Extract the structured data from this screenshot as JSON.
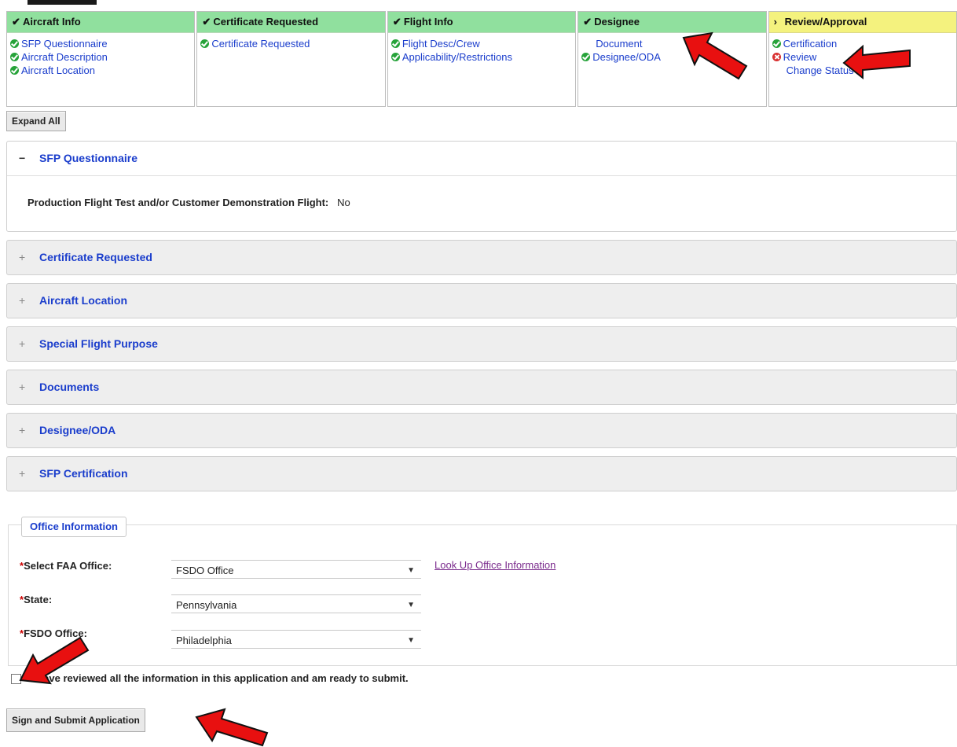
{
  "steps": [
    {
      "title": "Aircraft Info",
      "mark": "check",
      "items": [
        {
          "label": "SFP Questionnaire",
          "status": "ok"
        },
        {
          "label": "Aircraft Description",
          "status": "ok"
        },
        {
          "label": "Aircraft Location",
          "status": "ok"
        }
      ]
    },
    {
      "title": "Certificate Requested",
      "mark": "check",
      "items": [
        {
          "label": "Certificate Requested",
          "status": "ok"
        }
      ]
    },
    {
      "title": "Flight Info",
      "mark": "check",
      "items": [
        {
          "label": "Flight Desc/Crew",
          "status": "ok"
        },
        {
          "label": "Applicability/Restrictions",
          "status": "ok"
        }
      ]
    },
    {
      "title": "Designee",
      "mark": "check",
      "items": [
        {
          "label": "Document",
          "status": "none"
        },
        {
          "label": "Designee/ODA",
          "status": "ok"
        }
      ]
    },
    {
      "title": "Review/Approval",
      "mark": "current",
      "items": [
        {
          "label": "Certification",
          "status": "ok"
        },
        {
          "label": "Review",
          "status": "error"
        },
        {
          "label": "Change Status",
          "status": "none"
        }
      ]
    }
  ],
  "expand_all": "Expand All",
  "questionnaire": {
    "title": "SFP Questionnaire",
    "question": "Production Flight Test and/or Customer Demonstration Flight:",
    "answer": "No"
  },
  "sections": [
    "Certificate Requested",
    "Aircraft Location",
    "Special Flight Purpose",
    "Documents",
    "Designee/ODA",
    "SFP Certification"
  ],
  "office": {
    "legend": "Office Information",
    "faa_label": "Select FAA Office:",
    "faa_value": "FSDO Office",
    "lookup": "Look Up Office Information",
    "state_label": "State:",
    "state_value": "Pennsylvania",
    "fsdo_label": "FSDO Office:",
    "fsdo_value": "Philadelphia",
    "required_mark": "*"
  },
  "confirm_text": "I have reviewed all the information in this application and am ready to submit.",
  "submit": "Sign and Submit Application",
  "colors": {
    "complete": "#90e09e",
    "current": "#f4f27e",
    "link": "#1a3dcc",
    "annotation": "#e81010"
  }
}
